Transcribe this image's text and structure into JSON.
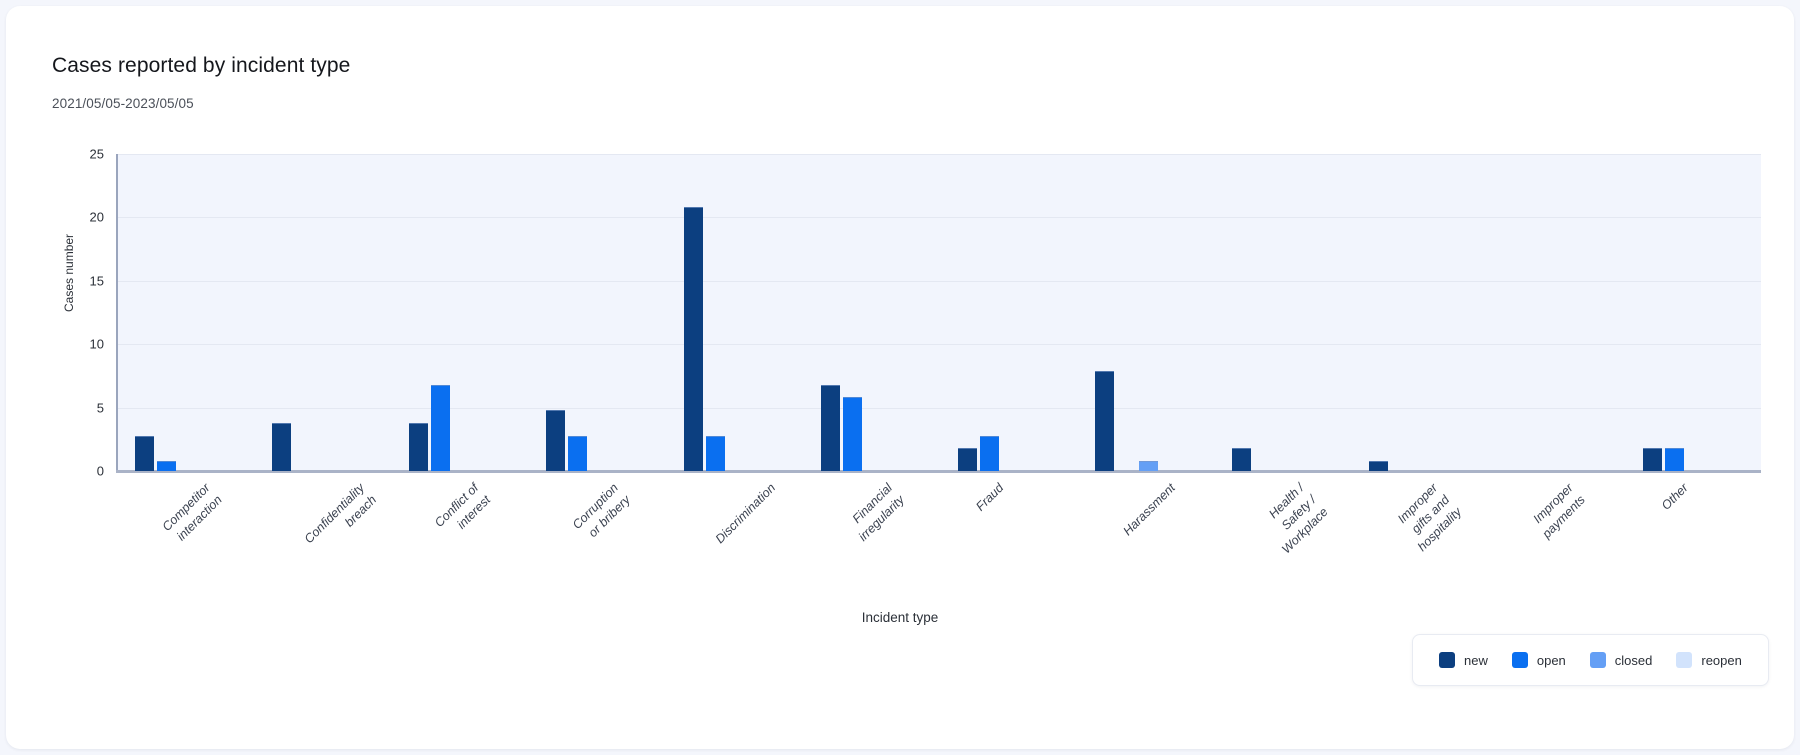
{
  "card": {
    "title": "Cases reported by incident type",
    "subtitle": "2021/05/05-2023/05/05"
  },
  "chart_data": {
    "type": "bar",
    "title": "Cases reported by incident type",
    "subtitle": "2021/05/05-2023/05/05",
    "xlabel": "Incident type",
    "ylabel": "Cases number",
    "ylim": [
      0,
      25
    ],
    "yticks": [
      0,
      5,
      10,
      15,
      20,
      25
    ],
    "grid": true,
    "legend_position": "bottom-right",
    "grouped": true,
    "categories": [
      "Competitor\ninteraction",
      "Confidentiality\nbreach",
      "Conflict of\ninterest",
      "Corruption\nor bribery",
      "Discrimination",
      "Financial\nirregularity",
      "Fraud",
      "Harassment",
      "Health /\nSafety /\nWorkplace",
      "Improper\ngifts and\nhospitality",
      "Improper\npayments",
      "Other"
    ],
    "series": [
      {
        "name": "new",
        "color": "#0c3f80",
        "values": [
          2.8,
          3.8,
          3.8,
          4.8,
          20.8,
          6.8,
          1.8,
          7.9,
          1.8,
          0.8,
          0,
          1.8
        ]
      },
      {
        "name": "open",
        "color": "#0a6ff0",
        "values": [
          0.8,
          0,
          6.8,
          2.8,
          2.8,
          5.8,
          2.8,
          0,
          0,
          0,
          0,
          1.8
        ]
      },
      {
        "name": "closed",
        "color": "#649ff5",
        "values": [
          0,
          0,
          0,
          0,
          0,
          0,
          0,
          0.8,
          0,
          0,
          0,
          0
        ]
      },
      {
        "name": "reopen",
        "color": "#d2e3fc",
        "values": [
          0,
          0,
          0,
          0,
          0,
          0,
          0,
          0,
          0,
          0,
          0,
          0
        ]
      }
    ]
  }
}
